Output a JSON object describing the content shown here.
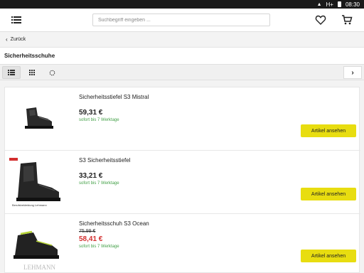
{
  "status": {
    "network": "H+",
    "time": "08:30"
  },
  "header": {
    "search_placeholder": "Suchbegriff eingeben ..."
  },
  "nav": {
    "back_label": "Zurück"
  },
  "category": {
    "title": "Sicherheitsschuhe"
  },
  "products": [
    {
      "name": "Sicherheitsstiefel S3 Mistral",
      "old_price": "",
      "price": "59,31 €",
      "availability": "sofort bis 7 Werktage",
      "button": "Artikel ansehen",
      "image_brand": ""
    },
    {
      "name": "S3 Sicherheitsstiefel",
      "old_price": "",
      "price": "33,21 €",
      "availability": "sofort bis 7 Werktage",
      "button": "Artikel ansehen",
      "image_brand": "Berufsbekleidung Lehmann"
    },
    {
      "name": "Sicherheitsschuh S3 Ocean",
      "old_price": "75,99 €",
      "price": "58,41 €",
      "availability": "sofort bis 7 Werktage",
      "button": "Artikel ansehen",
      "image_brand": "LEHMANN"
    }
  ],
  "colors": {
    "accent": "#e8dd10",
    "sale": "#d32f2f",
    "availability": "#43a047"
  }
}
